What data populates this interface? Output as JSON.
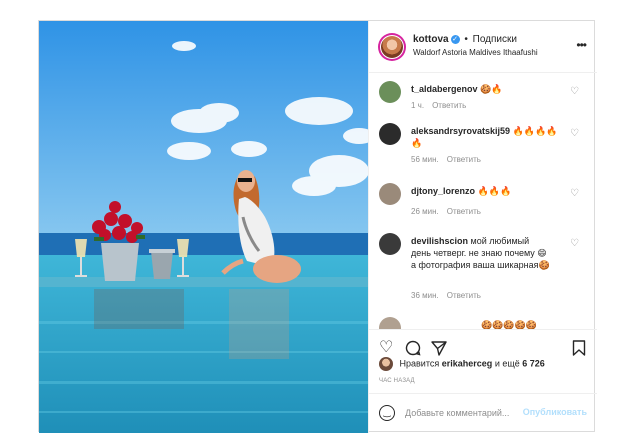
{
  "header": {
    "username": "kottova",
    "separator": "•",
    "follow_label": "Подписки",
    "location": "Waldorf Astoria Maldives Ithaafushi",
    "more_icon": "more-horizontal-icon"
  },
  "comments": [
    {
      "username": "t_aldabergenov",
      "text": "🍪🔥",
      "time": "1 ч.",
      "reply": "Ответить",
      "avatar_color": "#6b8f5a"
    },
    {
      "username": "aleksandrsyrovatskij59",
      "text": "🔥🔥🔥🔥🔥",
      "time": "56 мин.",
      "reply": "Ответить",
      "avatar_color": "#2b2b2b"
    },
    {
      "username": "djtony_lorenzo",
      "text": "🔥🔥🔥",
      "time": "26 мин.",
      "reply": "Ответить",
      "avatar_color": "#9a8a7a"
    },
    {
      "username": "devilishscion",
      "text": "мой любимый день четверг. не знаю почему 😄 а фотография ваша шикарная🍪",
      "time": "36 мин.",
      "reply": "Ответить",
      "avatar_color": "#3a3a3a"
    },
    {
      "username": "",
      "text": "🍪🍪🍪🍪🍪",
      "time": "",
      "reply": "",
      "avatar_color": "#b0a090"
    }
  ],
  "actions": {
    "like_icon": "heart-icon",
    "comment_icon": "comment-bubble-icon",
    "share_icon": "paper-plane-icon",
    "save_icon": "bookmark-icon"
  },
  "likes": {
    "prefix": "Нравится",
    "user": "erikaherceg",
    "suffix_word": "и ещё",
    "count": "6 726"
  },
  "time_ago": "ЧАС НАЗАД",
  "add_comment": {
    "placeholder": "Добавьте комментарий...",
    "publish_label": "Опубликовать",
    "emoji_icon": "smiley-icon"
  },
  "colors": {
    "link_disabled": "#b2dffc",
    "verified": "#3897f0",
    "muted": "#8e8e8e",
    "border": "#dbdbdb"
  }
}
